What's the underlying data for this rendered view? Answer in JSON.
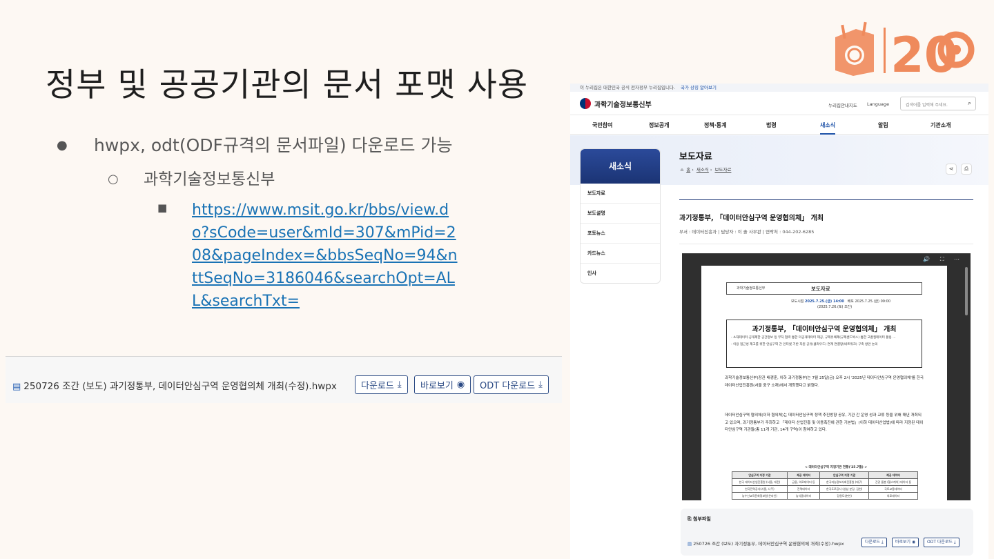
{
  "slide": {
    "title": "정부 및 공공기관의 문서 포맷 사용",
    "logo_text": "20",
    "bullet1": "hwpx, odt(ODF규격의 문서파일) 다운로드 가능",
    "bullet1_dot": "●",
    "bullet2": "과학기술정보통신부",
    "bullet2_dot": "○",
    "bullet3_dot": "■",
    "link": "https://www.msit.go.kr/bbs/view.do?sCode=user&mId=307&mPid=208&pageIndex=&bbsSeqNo=94&nttSeqNo=3186046&searchOpt=ALL&searchTxt="
  },
  "attachment_strip": {
    "file_icon": "file-icon",
    "filename": "250726 조간 (보도) 과기정통부, 데이터안심구역 운영협의체 개최(수정).hwpx",
    "download_label": "다운로드",
    "preview_label": "바로보기",
    "odt_label": "ODT 다운로드",
    "download_glyph": "⤓",
    "preview_glyph": "◉"
  },
  "site": {
    "gov_notice": "이 누리집은 대한민국 공식 전자정부 누리집입니다.",
    "gov_link": "국가 상징 알아보기",
    "brand": "과학기술정보통신부",
    "util_sitemap": "누리집안내지도",
    "util_language": "Language",
    "search_placeholder": "검색어를 입력해 주세요.",
    "nav": [
      "국민참여",
      "정보공개",
      "정책·통계",
      "법령",
      "새소식",
      "알림",
      "기관소개"
    ],
    "side_title": "새소식",
    "side_items": [
      "보도자료",
      "보도설명",
      "포토뉴스",
      "카드뉴스",
      "인사"
    ],
    "page_title": "보도자료",
    "crumb_home": "홈",
    "crumb_1": "새소식",
    "crumb_2": "보도자료",
    "article_title": "과기정통부, 「데이터안심구역 운영협의체」 개최",
    "meta": "부서 : 데이터진흥과  |  담당자 : 이 솔 사무관  |  연락처 : 044-202-6285",
    "viewer_controls": "🔊 ⛶ ⋯",
    "doc": {
      "org": "과학기술정보통신부",
      "label": "보도자료",
      "release_label": "보도시점",
      "release_time": "2025.7.25.(금) 14:00",
      "release_note": "(2025.7.26.(토) 조간)",
      "dist_label": "배포",
      "dist_time": "2025.7.25.(금) 09:00",
      "headline": "과기정통부, 「데이터안심구역 운영협의체」 개최",
      "line1": "- 소재데이터·공개제한 공간정보 등 부처 협력 통한 미공개데이터 제공, 규제유예제(규제샌드박스) 통한 고품질데이터 활용 ...",
      "line2": "- 이용 접근성 제고를 위한 안심구역 간 인터넷 기반 자원 공유(클라우드) 연계 연결망(네트워크) 구축 방안 논의",
      "para1": "과학기술정보통신부(장관 배경훈, 이하 과기정통부)는 7월 25일(금) 오후 2시 '2025년 데이터안심구역 운영협의체'를 한국데이터산업진흥원(서울 중구 소재)에서 개최했다고 밝혔다.",
      "para2": "데이터안심구역 협의체(이하 협의체)는 데이터안심구역 정책 추진방향 공유, 기관 간 운영 성과 교류 등을 위해 매년 개최되고 있으며, 과기정통부가 주최하고 「데이터 산업진흥 및 이용촉진에 관한 기본법」(이하 데이터산업법)에 따라 지정된 데이터안심구역 기관들(총 11개 기관, 14개 구역)이 참여하고 있다.",
      "table_caption": "< 데이터안심구역 지정기관 현황('25.7월) >",
      "table_head": [
        "안심구역 지정 기관",
        "제공 데이터",
        "안심구역 지정 기관",
        "제공 데이터"
      ],
      "table_rows": [
        [
          "한국 데이터산업진흥원 (서울, 대전)",
          "금융, 의료데이터 등",
          "한국지능정보사회진흥원 (대구)",
          "건강 돌봄 (헬스케어) 데이터 등"
        ],
        [
          "한국전력공사(서울, 나주)",
          "전력데이터",
          "한국도로공사 (성남 분당, 김천)",
          "국토교통데이터"
        ],
        [
          "농수산교육문화정보원(온라인)",
          "농식품데이터",
          "강원도(춘천)",
          "의료데이터"
        ]
      ]
    },
    "attach_label": "첨부파일",
    "attach_file": "250726 조간 (보도) 과기정통부, 데이터안심구역 운영협의체 개최(수정).hwpx",
    "attach_download": "다운로드 ⤓",
    "attach_preview": "바로보기 ◉",
    "attach_odt": "ODT 다운로드 ⤓"
  },
  "colors": {
    "background": "#fdf8f3",
    "link": "#1a73b5",
    "brand_blue": "#1b3474",
    "logo_orange": "#ef8a5c"
  }
}
